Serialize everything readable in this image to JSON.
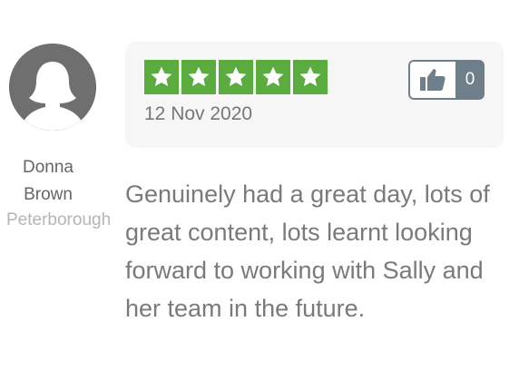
{
  "reviewer": {
    "name": "Donna Brown",
    "location": "Peterborough"
  },
  "review": {
    "rating": 5,
    "rating_max": 5,
    "date": "12 Nov 2020",
    "text": "Genuinely had a great day, lots of great content, lots learnt looking forward to working with Sally and her team in the future.",
    "like_count": "0"
  },
  "icons": {
    "avatar": "default-user-silhouette-icon",
    "star": "star-icon",
    "like": "thumbs-up-icon"
  },
  "colors": {
    "star_green": "#5aac3e",
    "like_slate": "#6f7f89",
    "text_gray": "#7a7a7a",
    "location_gray": "#b5b5b5"
  }
}
